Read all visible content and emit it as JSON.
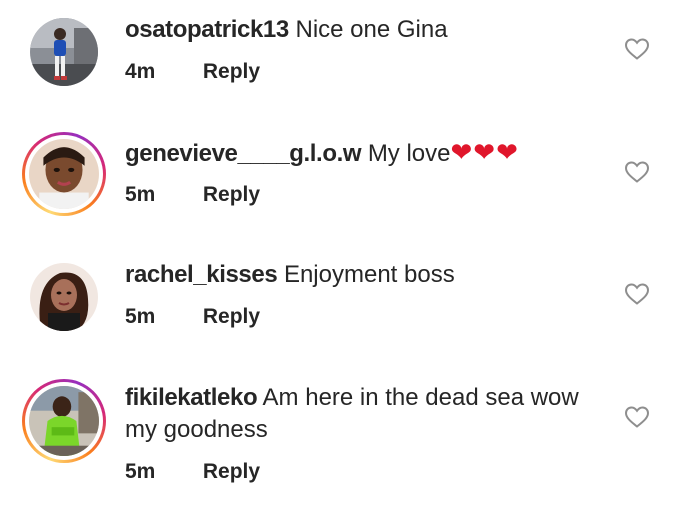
{
  "comments": [
    {
      "username": "osatopatrick13",
      "text": "Nice one Gina",
      "time": "4m",
      "reply_label": "Reply",
      "avatar_ring": "none"
    },
    {
      "username": "genevieve____g.l.o.w",
      "text": "My love",
      "hearts": "❤❤❤",
      "time": "5m",
      "reply_label": "Reply",
      "avatar_ring": "story"
    },
    {
      "username": "rachel_kisses",
      "text": "Enjoyment boss",
      "time": "5m",
      "reply_label": "Reply",
      "avatar_ring": "none"
    },
    {
      "username": "fikilekatleko",
      "text": "Am here in the dead sea wow my goodness",
      "time": "5m",
      "reply_label": "Reply",
      "avatar_ring": "story"
    }
  ],
  "icons": {
    "like": "heart-outline-icon"
  },
  "colors": {
    "text": "#262626",
    "heart": "#e0162b",
    "like_icon": "#8e8e8e"
  }
}
